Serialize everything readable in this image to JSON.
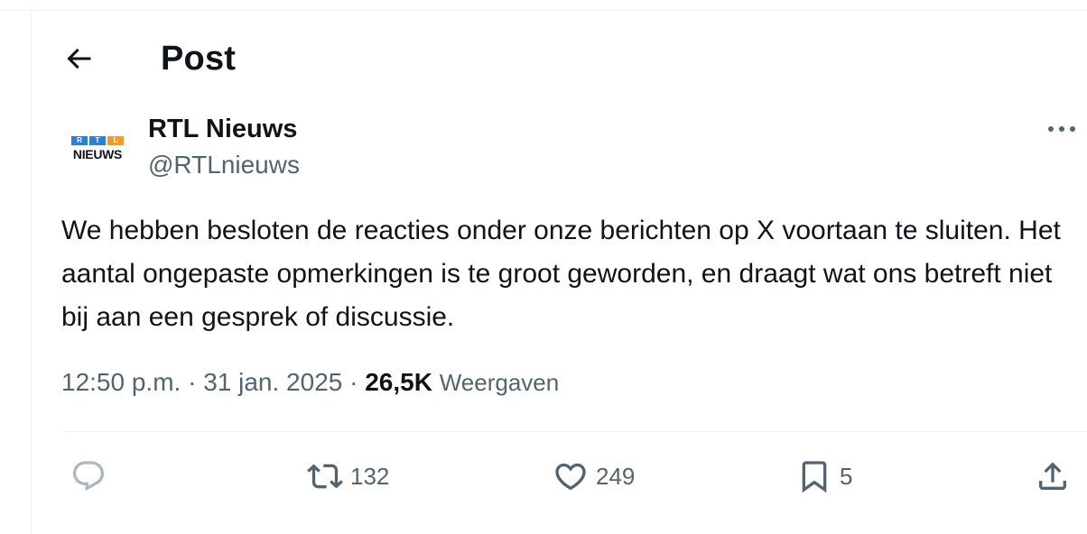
{
  "header": {
    "title": "Post"
  },
  "author": {
    "display_name": "RTL Nieuws",
    "handle": "@RTLnieuws",
    "logo_letters": [
      "R",
      "T",
      "L"
    ],
    "logo_word": "NIEUWS"
  },
  "post": {
    "text": "We hebben besloten de reacties onder onze berichten op X voortaan te sluiten. Het aantal ongepaste opmerkingen is te groot geworden, en draagt wat ons betreft niet bij aan een gesprek of discussie.",
    "time": "12:50 p.m.",
    "separator": "·",
    "date": "31 jan. 2025",
    "views_count": "26,5K",
    "views_label": "Weergaven"
  },
  "actions": {
    "reposts": "132",
    "likes": "249",
    "bookmarks": "5"
  },
  "colors": {
    "text_primary": "#0f1419",
    "text_secondary": "#536471",
    "divider": "#eff3f4",
    "reply_icon": "#aab8c2",
    "logo_blue": "#2d7fd3",
    "logo_orange": "#f39a2b"
  },
  "icons": {
    "back": "arrow-left-icon",
    "more": "more-horizontal-icon",
    "reply": "reply-icon",
    "repost": "repost-icon",
    "like": "heart-icon",
    "bookmark": "bookmark-icon",
    "share": "share-icon"
  }
}
